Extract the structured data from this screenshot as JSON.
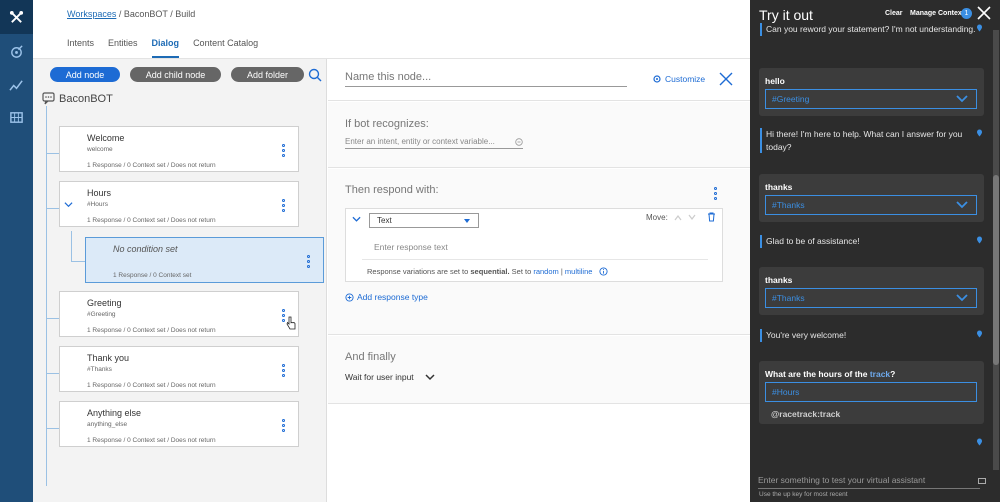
{
  "colors": {
    "accent": "#1d6bd4",
    "rail": "#1f4e79",
    "chat_bg": "#2c2c2c",
    "selected_node": "#dceaf8"
  },
  "breadcrumb": {
    "link": "Workspaces",
    "rest": " / BaconBOT / Build"
  },
  "tabs": [
    "Intents",
    "Entities",
    "Dialog",
    "Content Catalog"
  ],
  "active_tab": "Dialog",
  "tree": {
    "add_node": "Add node",
    "add_child_node": "Add child node",
    "add_folder": "Add folder",
    "bot_name": "BaconBOT",
    "nodes": [
      {
        "title": "Welcome",
        "condition": "welcome",
        "meta": "1 Response / 0 Context set / Does not return"
      },
      {
        "title": "Hours",
        "condition": "#Hours",
        "meta": "1 Response / 0 Context set / Does not return"
      },
      {
        "title": "No condition set",
        "meta": "1 Response / 0 Context set"
      },
      {
        "title": "Greeting",
        "condition": "#Greeting",
        "meta": "1 Response / 0 Context set / Does not return"
      },
      {
        "title": "Thank you",
        "condition": "#Thanks",
        "meta": "1 Response / 0 Context set / Does not return"
      },
      {
        "title": "Anything else",
        "condition": "anything_else",
        "meta": "1 Response / 0 Context set / Does not return"
      }
    ]
  },
  "editor": {
    "name_placeholder": "Name this node...",
    "customize": "Customize",
    "if_recognizes": "If bot recognizes:",
    "condition_placeholder": "Enter an intent, entity or context variable...",
    "then_respond": "Then respond with:",
    "response_type": "Text",
    "move_label": "Move:",
    "response_placeholder": "Enter response text",
    "variations_prefix": "Response variations are set to ",
    "variations_mode": "sequential.",
    "variations_setto": " Set to ",
    "variations_random": "random",
    "variations_sep": " | ",
    "variations_multiline": "multiline",
    "add_response_type": "Add response type",
    "and_finally": "And finally",
    "wait_for_input": "Wait for user input"
  },
  "chat": {
    "title": "Try it out",
    "clear": "Clear",
    "manage_context": "Manage Context",
    "context_count": "1",
    "messages": {
      "bot1": "Can you reword your statement? I'm not understanding.",
      "user1": "hello",
      "intent1": "#Greeting",
      "bot2": "Hi there! I'm here to help. What can I answer for you today?",
      "user2": "thanks",
      "intent2": "#Thanks",
      "bot3": "Glad to be of assistance!",
      "user3": "thanks",
      "intent3": "#Thanks",
      "bot4": "You're very welcome!",
      "user4_pre": "What are the hours of the ",
      "user4_link": "track",
      "user4_post": "?",
      "intent4": "#Hours",
      "entity4": "@racetrack:track"
    },
    "input_placeholder": "Enter something to test your virtual assistant",
    "hint": "Use the up key for most recent"
  }
}
